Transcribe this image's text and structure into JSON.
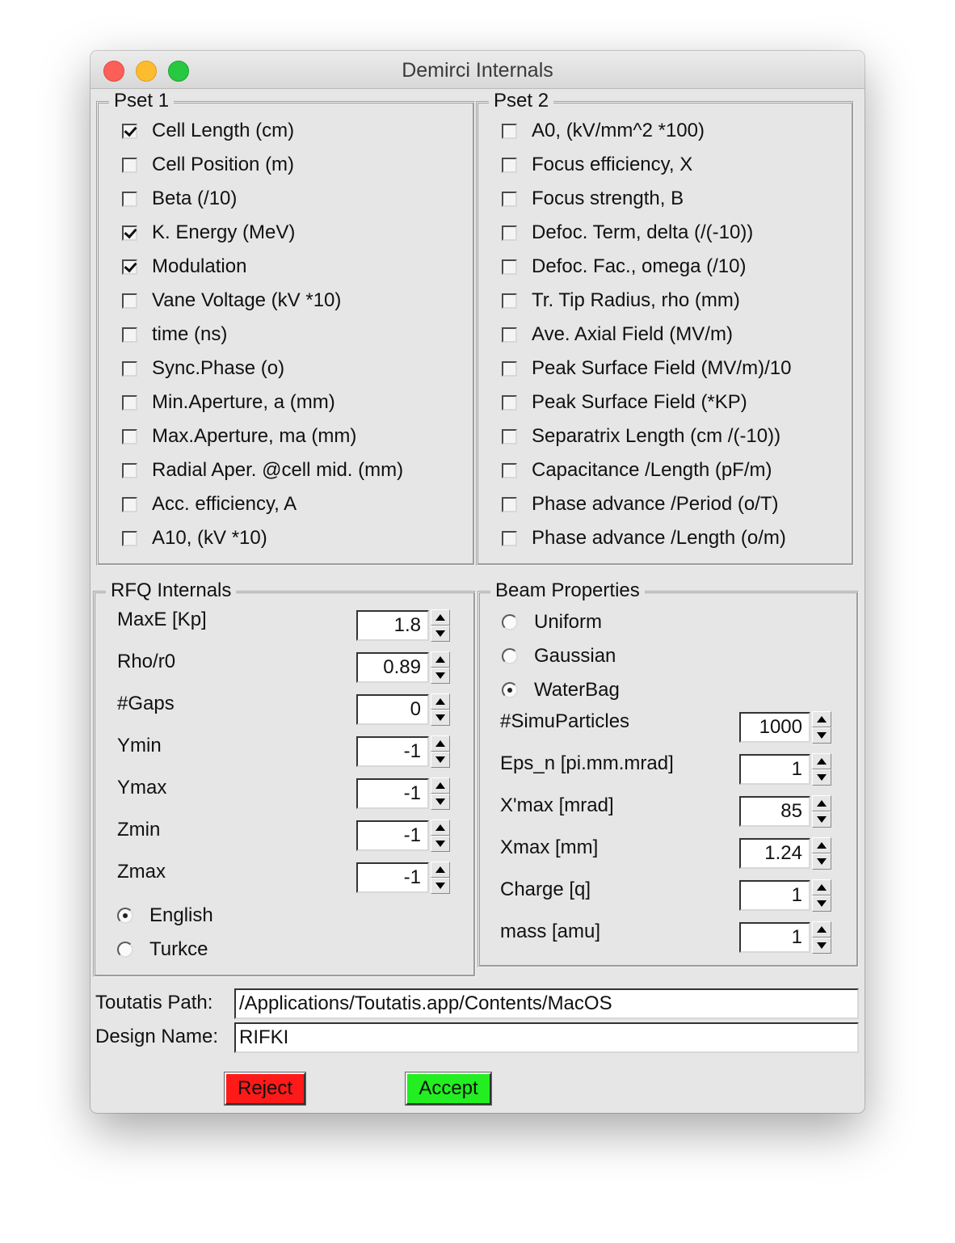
{
  "window": {
    "title": "Demirci Internals"
  },
  "pset1": {
    "title": "Pset 1",
    "items": [
      {
        "label": "Cell Length (cm)",
        "checked": true
      },
      {
        "label": "Cell Position (m)",
        "checked": false
      },
      {
        "label": "Beta (/10)",
        "checked": false
      },
      {
        "label": "K. Energy (MeV)",
        "checked": true
      },
      {
        "label": "Modulation",
        "checked": true
      },
      {
        "label": "Vane Voltage (kV *10)",
        "checked": false
      },
      {
        "label": "time (ns)",
        "checked": false
      },
      {
        "label": "Sync.Phase (o)",
        "checked": false
      },
      {
        "label": "Min.Aperture, a (mm)",
        "checked": false
      },
      {
        "label": "Max.Aperture, ma (mm)",
        "checked": false
      },
      {
        "label": "Radial Aper. @cell mid. (mm)",
        "checked": false
      },
      {
        "label": "Acc. efficiency, A",
        "checked": false
      },
      {
        "label": "A10, (kV *10)",
        "checked": false
      }
    ]
  },
  "pset2": {
    "title": "Pset 2",
    "items": [
      {
        "label": "A0, (kV/mm^2 *100)",
        "checked": false
      },
      {
        "label": "Focus efficiency, X",
        "checked": false
      },
      {
        "label": "Focus strength, B",
        "checked": false
      },
      {
        "label": "Defoc. Term, delta (/(-10))",
        "checked": false
      },
      {
        "label": "Defoc. Fac., omega (/10)",
        "checked": false
      },
      {
        "label": "Tr. Tip Radius, rho (mm)",
        "checked": false
      },
      {
        "label": "Ave. Axial Field (MV/m)",
        "checked": false
      },
      {
        "label": "Peak Surface Field (MV/m)/10",
        "checked": false
      },
      {
        "label": "Peak Surface Field (*KP)",
        "checked": false
      },
      {
        "label": "Separatrix Length (cm /(-10))",
        "checked": false
      },
      {
        "label": "Capacitance /Length (pF/m)",
        "checked": false
      },
      {
        "label": "Phase advance /Period (o/T)",
        "checked": false
      },
      {
        "label": "Phase advance /Length (o/m)",
        "checked": false
      }
    ]
  },
  "rfq": {
    "title": "RFQ Internals",
    "fields": [
      {
        "label": "MaxE [Kp]",
        "value": "1.8"
      },
      {
        "label": "Rho/r0",
        "value": "0.89"
      },
      {
        "label": "#Gaps",
        "value": "0"
      },
      {
        "label": "Ymin",
        "value": "-1"
      },
      {
        "label": "Ymax",
        "value": "-1"
      },
      {
        "label": "Zmin",
        "value": "-1"
      },
      {
        "label": "Zmax",
        "value": "-1"
      }
    ],
    "languages": [
      {
        "label": "English",
        "selected": true
      },
      {
        "label": "Turkce",
        "selected": false
      }
    ]
  },
  "beam": {
    "title": "Beam Properties",
    "distributions": [
      {
        "label": "Uniform",
        "selected": false
      },
      {
        "label": "Gaussian",
        "selected": false
      },
      {
        "label": "WaterBag",
        "selected": true
      }
    ],
    "fields": [
      {
        "label": "#SimuParticles",
        "value": "1000"
      },
      {
        "label": "Eps_n [pi.mm.mrad]",
        "value": "1"
      },
      {
        "label": "X'max [mrad]",
        "value": "85"
      },
      {
        "label": "Xmax [mm]",
        "value": "1.24"
      },
      {
        "label": "Charge [q]",
        "value": "1"
      },
      {
        "label": "mass [amu]",
        "value": "1"
      }
    ]
  },
  "paths": {
    "toutatis_label": "Toutatis Path:",
    "toutatis_value": "/Applications/Toutatis.app/Contents/MacOS",
    "design_label": "Design Name:",
    "design_value": "RIFKI"
  },
  "buttons": {
    "reject_label": "Reject",
    "accept_label": "Accept",
    "reject_color": "#ff1a1a",
    "accept_color": "#22ee22"
  }
}
